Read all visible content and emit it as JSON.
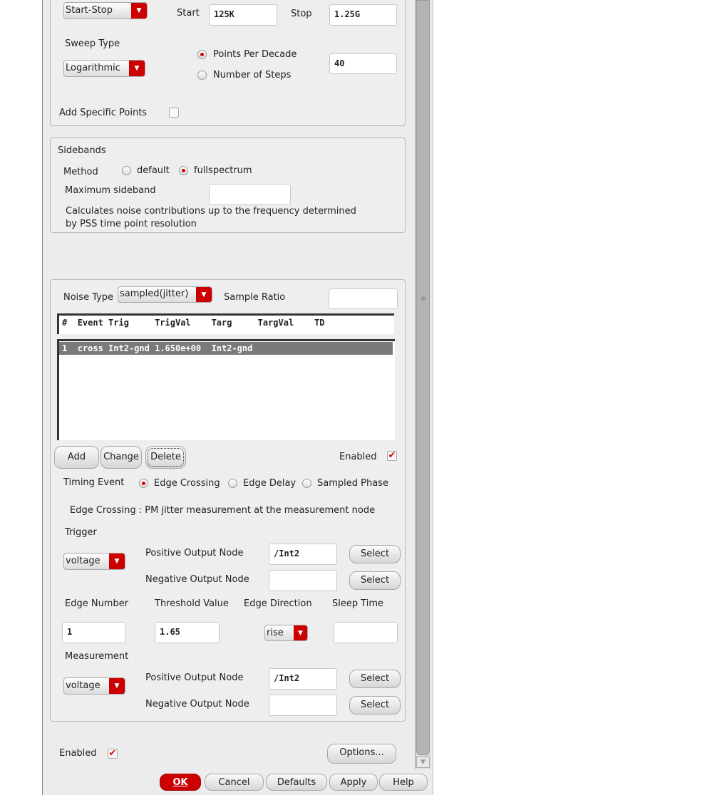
{
  "sweep": {
    "range_type": "Start-Stop",
    "start_label": "Start",
    "start_value": "125K",
    "stop_label": "Stop",
    "stop_value": "1.25G",
    "sweep_type_label": "Sweep Type",
    "sweep_type": "Logarithmic",
    "points_per_decade_label": "Points Per Decade",
    "number_of_steps_label": "Number of Steps",
    "points_value": "40",
    "add_specific_points_label": "Add Specific Points"
  },
  "sidebands": {
    "title": "Sidebands",
    "method_label": "Method",
    "default_label": "default",
    "fullspectrum_label": "fullspectrum",
    "max_sideband_label": "Maximum sideband",
    "max_sideband_value": "",
    "note_line1": "Calculates noise contributions up to the frequency determined",
    "note_line2": "by PSS time point resolution"
  },
  "noise": {
    "noise_type_label": "Noise Type",
    "noise_type": "sampled(jitter)",
    "sample_ratio_label": "Sample Ratio",
    "sample_ratio_value": "",
    "table": {
      "headers": [
        "#",
        "Event",
        "Trig",
        "TrigVal",
        "Targ",
        "TargVal",
        "TD"
      ],
      "rows": [
        [
          "1",
          "cross",
          "Int2-gnd",
          "1.650e+00",
          "Int2-gnd",
          "",
          ""
        ]
      ]
    },
    "add_label": "Add",
    "change_label": "Change",
    "delete_label": "Delete",
    "enabled_label": "Enabled",
    "timing_event_label": "Timing Event",
    "edge_crossing_label": "Edge Crossing",
    "edge_delay_label": "Edge Delay",
    "sampled_phase_label": "Sampled Phase",
    "description": "Edge Crossing : PM jitter measurement at the measurement node",
    "trigger_label": "Trigger",
    "trigger_type": "voltage",
    "pos_node_label": "Positive Output Node",
    "neg_node_label": "Negative Output Node",
    "trigger_pos_value": "/Int2",
    "trigger_neg_value": "",
    "select_label": "Select",
    "edge_number_label": "Edge Number",
    "threshold_label": "Threshold Value",
    "edge_direction_label": "Edge Direction",
    "sleep_time_label": "Sleep Time",
    "edge_number_value": "1",
    "threshold_value": "1.65",
    "edge_direction": "rise",
    "sleep_time_value": "",
    "measurement_label": "Measurement",
    "measurement_type": "voltage",
    "meas_pos_value": "/Int2",
    "meas_neg_value": ""
  },
  "footer": {
    "enabled_label": "Enabled",
    "options_label": "Options...",
    "ok_label": "OK",
    "cancel_label": "Cancel",
    "defaults_label": "Defaults",
    "apply_label": "Apply",
    "help_label": "Help"
  },
  "colors": {
    "accent": "#cc0000",
    "selected_row": "#7a7a7a"
  }
}
